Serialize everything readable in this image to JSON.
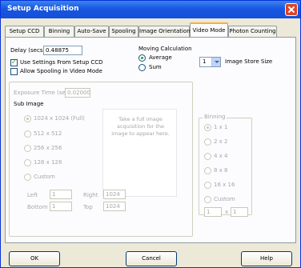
{
  "window": {
    "title": "Setup Acquisition"
  },
  "tabs": [
    {
      "label": "Setup CCD"
    },
    {
      "label": "Binning"
    },
    {
      "label": "Auto-Save"
    },
    {
      "label": "Spooling"
    },
    {
      "label": "Image Orientation"
    },
    {
      "label": "Video Mode"
    },
    {
      "label": "Photon Counting"
    }
  ],
  "video": {
    "delay_label": "Delay (secs)",
    "delay_value": "0.48875",
    "use_settings_label": "Use Settings From Setup CCD",
    "allow_spooling_label": "Allow Spooling in Video Mode",
    "moving_calc_title": "Moving Calculation",
    "average_label": "Average",
    "sum_label": "Sum",
    "store_size_value": "1",
    "store_size_label": "Image Store Size",
    "exposure_label": "Exposure Time (secs)",
    "exposure_value": "0.02000"
  },
  "sub_image": {
    "title": "Sub Image",
    "options": [
      "1024 x 1024 (Full)",
      "512 x 512",
      "256 x 256",
      "128 x 128",
      "Custom"
    ],
    "left_label": "Left",
    "left_value": "1",
    "right_label": "Right",
    "right_value": "1024",
    "bottom_label": "Bottom",
    "bottom_value": "1",
    "top_label": "Top",
    "top_value": "1024",
    "preview_text": "Take a full image acquisition for the image to appear here."
  },
  "binning": {
    "title": "Binning",
    "options": [
      "1 x 1",
      "2 x 2",
      "4 x 4",
      "8 x 8",
      "16 x 16",
      "Custom"
    ],
    "x_value": "1",
    "separator": "x",
    "y_value": "1"
  },
  "buttons": {
    "ok": "OK",
    "cancel": "Cancel",
    "help": "Help"
  }
}
